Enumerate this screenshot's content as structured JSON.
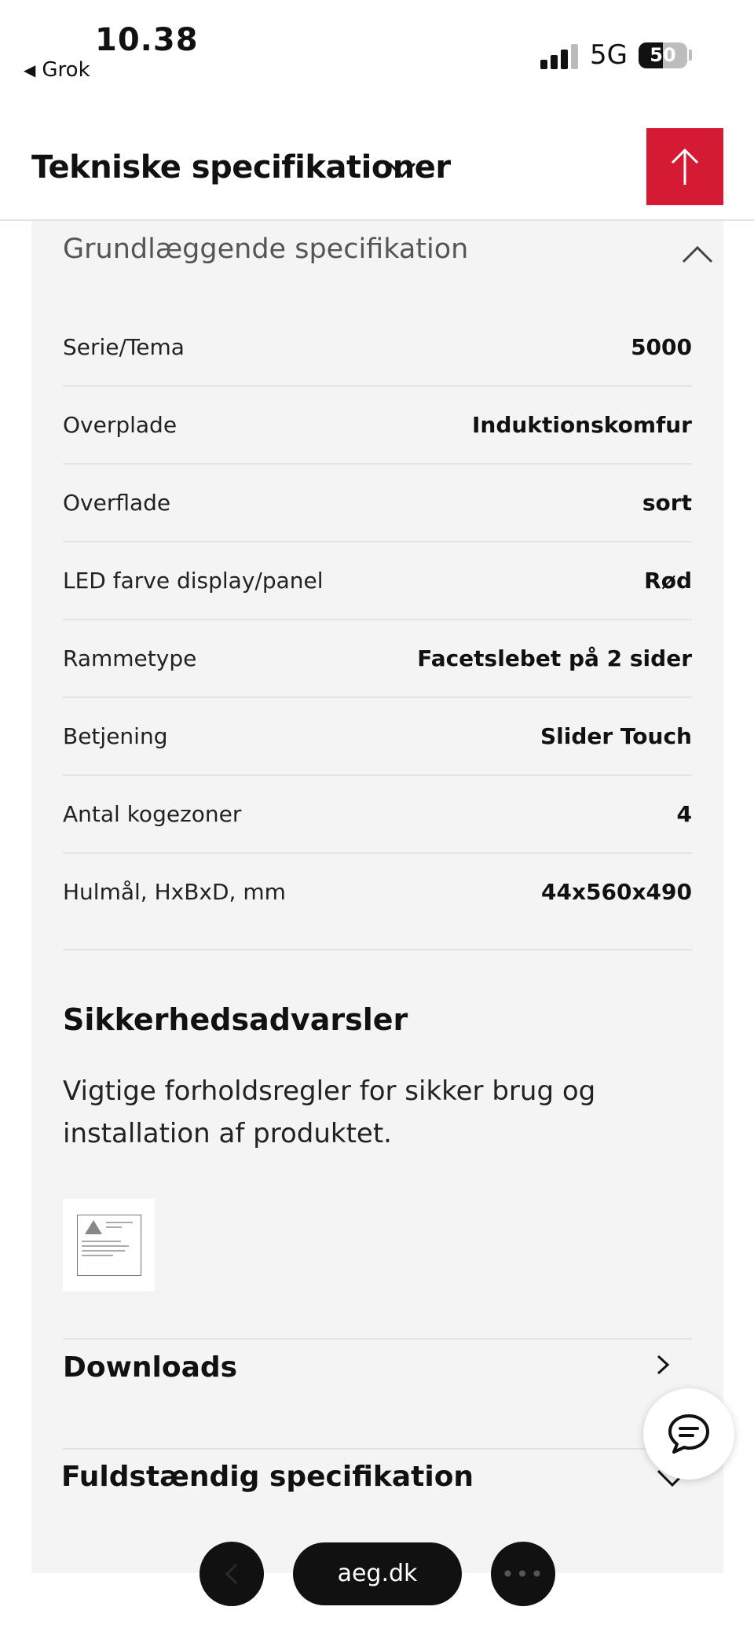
{
  "status_bar": {
    "time": "10.38",
    "back_app": "Grok",
    "network": "5G",
    "battery": "50",
    "battery_level": 0.5
  },
  "header": {
    "title": "Tekniske specifikationer"
  },
  "basic_spec": {
    "title": "Grundlæggende specifikation",
    "rows": [
      {
        "label": "Serie/Tema",
        "value": "5000"
      },
      {
        "label": "Overplade",
        "value": "Induktionskomfur"
      },
      {
        "label": "Overflade",
        "value": "sort"
      },
      {
        "label": "LED farve display/panel",
        "value": "Rød"
      },
      {
        "label": "Rammetype",
        "value": "Facetslebet på 2 sider"
      },
      {
        "label": "Betjening",
        "value": "Slider Touch"
      },
      {
        "label": "Antal kogezoner",
        "value": "4"
      },
      {
        "label": "Hulmål, HxBxD, mm",
        "value": "44x560x490"
      }
    ]
  },
  "safety": {
    "title": "Sikkerhedsadvarsler",
    "description": "Vigtige forholdsregler for sikker brug og installation af produktet."
  },
  "downloads": {
    "title": "Downloads"
  },
  "full_spec": {
    "title": "Fuldstændig specifikation"
  },
  "browser": {
    "url": "aeg.dk"
  },
  "colors": {
    "accent": "#d51a33",
    "panel": "#f4f4f4"
  }
}
